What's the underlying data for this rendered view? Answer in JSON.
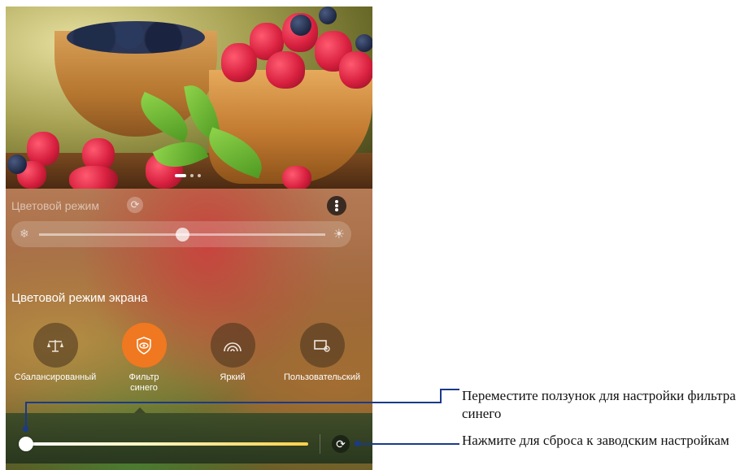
{
  "panel": {
    "color_mode_label": "Цветовой режим",
    "screen_mode_title": "Цветовой режим экрана",
    "temp_slider": {
      "value": 0.5
    },
    "blue_slider": {
      "value": 0.0
    }
  },
  "modes": [
    {
      "label": "Сбалансированный",
      "icon": "balance-scale-icon",
      "active": false
    },
    {
      "label": "Фильтр синего",
      "icon": "eye-shield-icon",
      "active": true
    },
    {
      "label": "Яркий",
      "icon": "rainbow-icon",
      "active": false
    },
    {
      "label": "Пользовательский",
      "icon": "custom-screen-icon",
      "active": false
    }
  ],
  "callouts": {
    "slider_note": "Переместите ползунок для настройки фильтра синего",
    "reset_note": "Нажмите для сброса к заводским настройкам"
  },
  "colors": {
    "accent": "#f07820",
    "callout": "#1a3a8a"
  }
}
